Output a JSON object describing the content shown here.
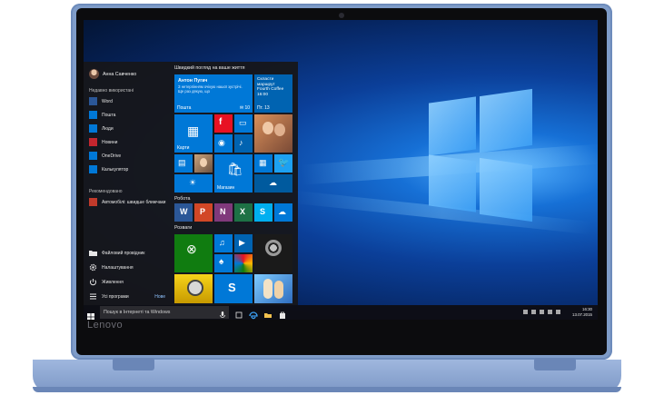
{
  "device": {
    "brand_logo": "Lenovo"
  },
  "start_menu": {
    "user_name": "Анна Савченко",
    "most_used_header": "Недавно використані",
    "most_used": [
      {
        "label": "Word",
        "icon": "word-icon",
        "color": "#2b5797"
      },
      {
        "label": "Пошта",
        "icon": "mail-icon",
        "color": "#0078d7"
      },
      {
        "label": "Люди",
        "icon": "people-icon",
        "color": "#0078d7"
      },
      {
        "label": "Новини",
        "icon": "news-icon",
        "color": "#c4262e"
      },
      {
        "label": "OneDrive",
        "icon": "onedrive-icon",
        "color": "#0078d7"
      },
      {
        "label": "Калькулятор",
        "icon": "calculator-icon",
        "color": "#0078d7"
      }
    ],
    "recommended_header": "Рекомендовано",
    "recommended": [
      {
        "label": "Автомобілі: швидше ближчаки",
        "icon": "cars-game-icon",
        "color": "#c03a2b"
      }
    ],
    "bottom_items": [
      {
        "label": "Файловий провідник",
        "icon": "folder-icon"
      },
      {
        "label": "Налаштування",
        "icon": "gear-icon"
      },
      {
        "label": "Живлення",
        "icon": "power-icon"
      },
      {
        "label": "Усі програми",
        "icon": "all-apps-icon",
        "badge": "Нове"
      }
    ],
    "tile_groups": {
      "life": "Швидкий погляд на ваше життя",
      "work": "Робота",
      "play": "Розваги"
    },
    "tiles": {
      "mail_title": "Антон Пугач",
      "mail_body": "З нетерпінням очікую нашої зустрічі. Ще раз дякую, що",
      "mail_label": "Пошта",
      "mail_count": "10",
      "calendar_title": "Скласти маршрут",
      "calendar_place": "Fourth Coffee",
      "calendar_time": "16:00",
      "calendar_label": "Пт. 13",
      "maps_label": "Карти",
      "store_label": "Магазин"
    }
  },
  "taskbar": {
    "search_placeholder": "Пошук в Інтернеті та Windows",
    "time": "16:30",
    "date": "13.07.2015"
  },
  "colors": {
    "accent": "#0078d7",
    "shell": "#7f9cc8",
    "desktop": "#0b3f99"
  }
}
